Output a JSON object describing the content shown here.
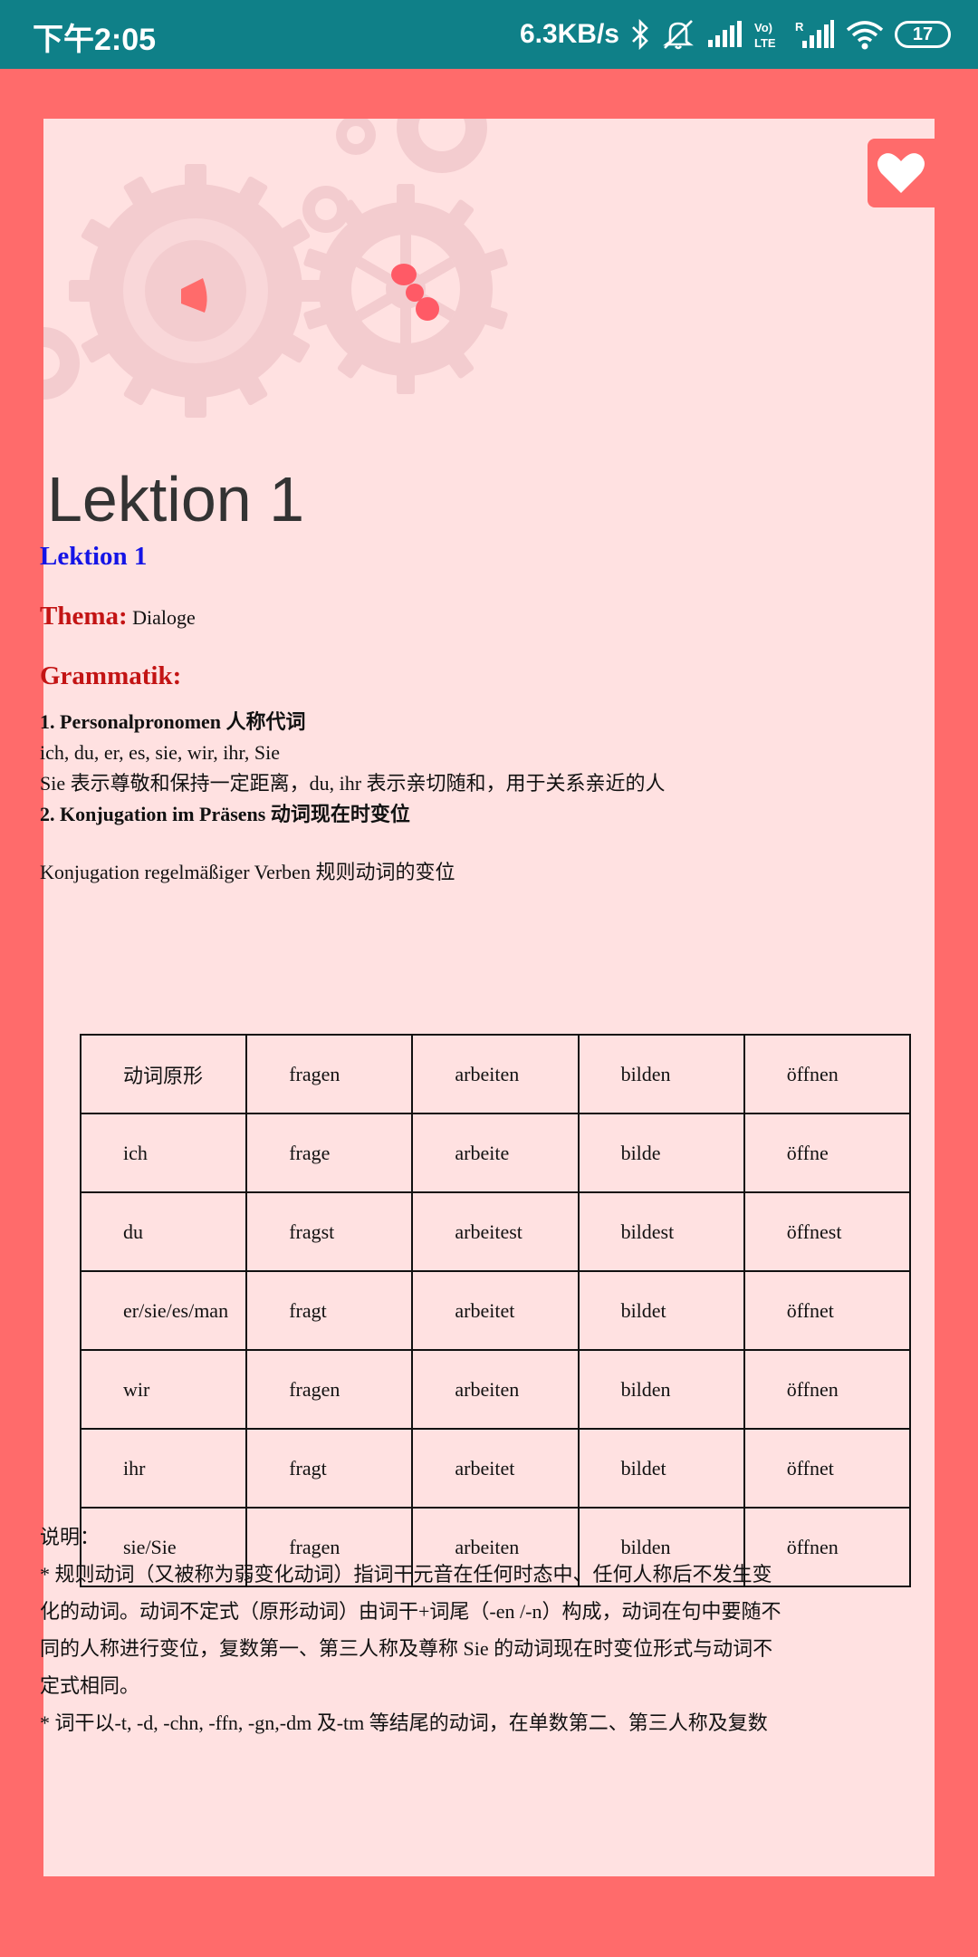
{
  "status_bar": {
    "time": "下午2:05",
    "net_speed": "6.3KB/s",
    "battery": "17",
    "icons": [
      "bluetooth-icon",
      "mute-icon",
      "signal-icon",
      "volte-icon",
      "roaming-signal-icon",
      "wifi-icon",
      "battery-icon"
    ]
  },
  "colors": {
    "status_bar": "#0F8088",
    "page_bg": "#FF6B6B",
    "card_bg": "#FFE1E1",
    "heading_blue": "#1414E6",
    "heading_red": "#C31414"
  },
  "header": {
    "lesson_title": "Lektion 1",
    "favorite_icon": "heart-icon"
  },
  "content": {
    "heading": "Lektion 1",
    "thema_label": "Thema:",
    "thema_value": "Dialoge",
    "grammatik_label": "Grammatik:",
    "point1_title": "1. Personalpronomen 人称代词",
    "pronouns": "ich, du, er, es, sie, wir, ihr, Sie",
    "sie_note": "Sie 表示尊敬和保持一定距离，du, ihr 表示亲切随和，用于关系亲近的人",
    "point2_title": "2. Konjugation im Präsens 动词现在时变位",
    "table_caption": "Konjugation regelmäßiger Verben   规则动词的变位"
  },
  "table": {
    "rows": [
      [
        "动词原形",
        "fragen",
        "arbeiten",
        "bilden",
        "öffnen"
      ],
      [
        "ich",
        "frage",
        "arbeite",
        "bilde",
        "öffne"
      ],
      [
        "du",
        "fragst",
        "arbeitest",
        "bildest",
        "öffnest"
      ],
      [
        "er/sie/es/man",
        "fragt",
        "arbeitet",
        "bildet",
        "öffnet"
      ],
      [
        "wir",
        "fragen",
        "arbeiten",
        "bilden",
        "öffnen"
      ],
      [
        "ihr",
        "fragt",
        "arbeitet",
        "bildet",
        "öffnet"
      ],
      [
        "sie/Sie",
        "fragen",
        "arbeiten",
        "bilden",
        "öffnen"
      ]
    ]
  },
  "notes": {
    "label": "说明：",
    "note1_line1": "*  规则动词（又被称为弱变化动词）指词干元音在任何时态中、任何人称后不发生变",
    "note1_line2": "化的动词。动词不定式（原形动词）由词干+词尾（-en /-n）构成，动词在句中要随不",
    "note1_line3": "同的人称进行变位，复数第一、第三人称及尊称 Sie 的动词现在时变位形式与动词不",
    "note1_line4": "定式相同。",
    "note2_line1": "*  词干以-t, -d, -chn, -ffn, -gn,-dm 及-tm 等结尾的动词，在单数第二、第三人称及复数"
  }
}
